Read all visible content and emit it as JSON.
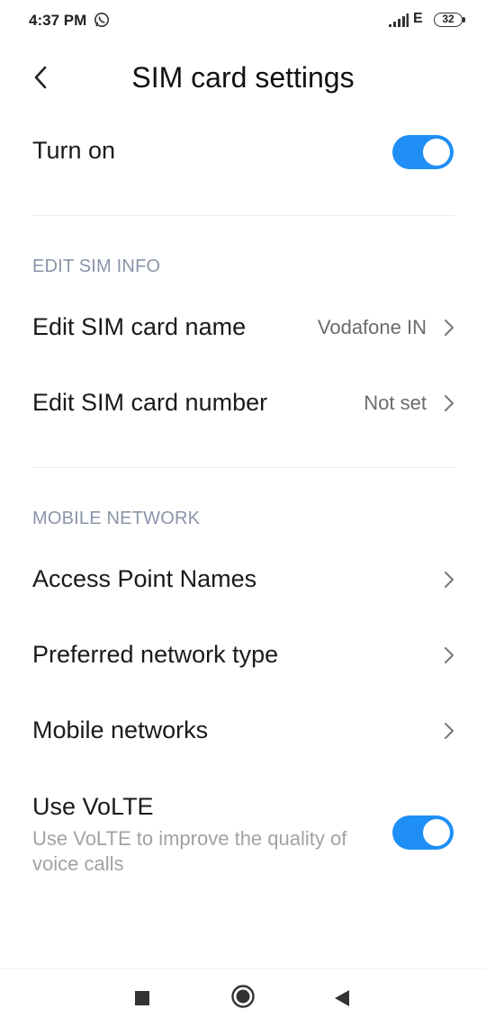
{
  "status_bar": {
    "time": "4:37 PM",
    "network_type": "E",
    "battery_level": "32",
    "icons": [
      "whatsapp-icon",
      "signal-icon"
    ]
  },
  "header": {
    "title": "SIM card settings",
    "back_icon": "chevron-left-icon"
  },
  "turn_on": {
    "label": "Turn on",
    "enabled": true
  },
  "edit_sim_info": {
    "section_title": "EDIT SIM INFO",
    "name_label": "Edit SIM card name",
    "name_value": "Vodafone IN",
    "number_label": "Edit SIM card number",
    "number_value": "Not set"
  },
  "mobile_network": {
    "section_title": "MOBILE NETWORK",
    "apn_label": "Access Point Names",
    "preferred_type_label": "Preferred network type",
    "mobile_networks_label": "Mobile networks"
  },
  "volte": {
    "label": "Use VoLTE",
    "description": "Use VoLTE to improve the quality of voice calls",
    "enabled": true
  },
  "colors": {
    "accent": "#1f8ff5",
    "section_header": "#8a94a8",
    "secondary_text": "#a2a2a2"
  },
  "nav_bar": {
    "icons": [
      "square-recents-icon",
      "circle-home-icon",
      "triangle-back-icon"
    ]
  }
}
